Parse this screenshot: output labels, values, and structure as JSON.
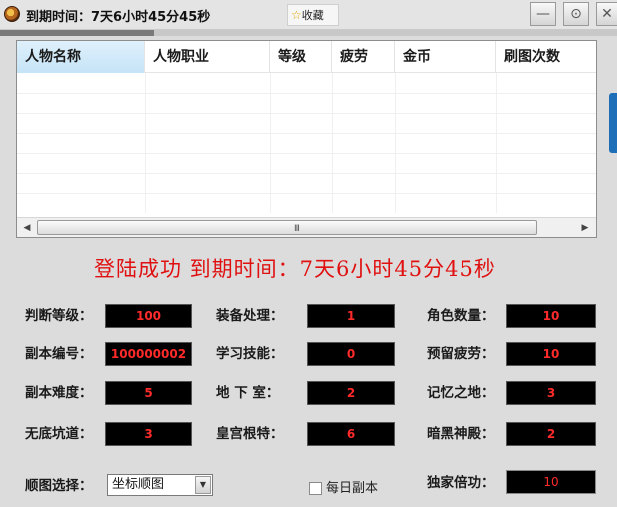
{
  "window": {
    "title": "到期时间：7天6小时45分45秒",
    "favorite_label": "收藏",
    "min_label": "—",
    "settings_label": "⊙",
    "close_label": "✕"
  },
  "progress": {
    "fraction": 0.25
  },
  "table": {
    "columns": [
      "人物名称",
      "人物职业",
      "等级",
      "疲劳",
      "金币",
      "刷图次数"
    ],
    "rows": [],
    "scroll_left": "◀",
    "scroll_right": "▶",
    "scroll_grip": "III"
  },
  "status_text": "登陆成功  到期时间：7天6小时45分45秒",
  "fields": [
    {
      "label": "判断等级：",
      "value": "100"
    },
    {
      "label": "装备处理：",
      "value": "1"
    },
    {
      "label": "角色数量：",
      "value": "10"
    },
    {
      "label": "副本编号：",
      "value": "100000002"
    },
    {
      "label": "学习技能：",
      "value": "0"
    },
    {
      "label": "预留疲劳：",
      "value": "10"
    },
    {
      "label": "副本难度：",
      "value": "5"
    },
    {
      "label": "地 下 室：",
      "value": "2"
    },
    {
      "label": "记忆之地：",
      "value": "3"
    },
    {
      "label": "无底坑道：",
      "value": "3"
    },
    {
      "label": "皇宫根特：",
      "value": "6"
    },
    {
      "label": "暗黑神殿：",
      "value": "2"
    }
  ],
  "route_select": {
    "label": "顺图选择：",
    "value": "坐标顺图",
    "arrow": "▼"
  },
  "daily_dungeon": {
    "label": "每日副本",
    "checked": false
  },
  "exclusive_multiplier": {
    "label": "独家倍功：",
    "value": "10"
  },
  "colors": {
    "value_text": "#ff2a2a",
    "status_text": "#e01010",
    "value_bg": "#000000",
    "selected_header": "#c5e4f7"
  }
}
